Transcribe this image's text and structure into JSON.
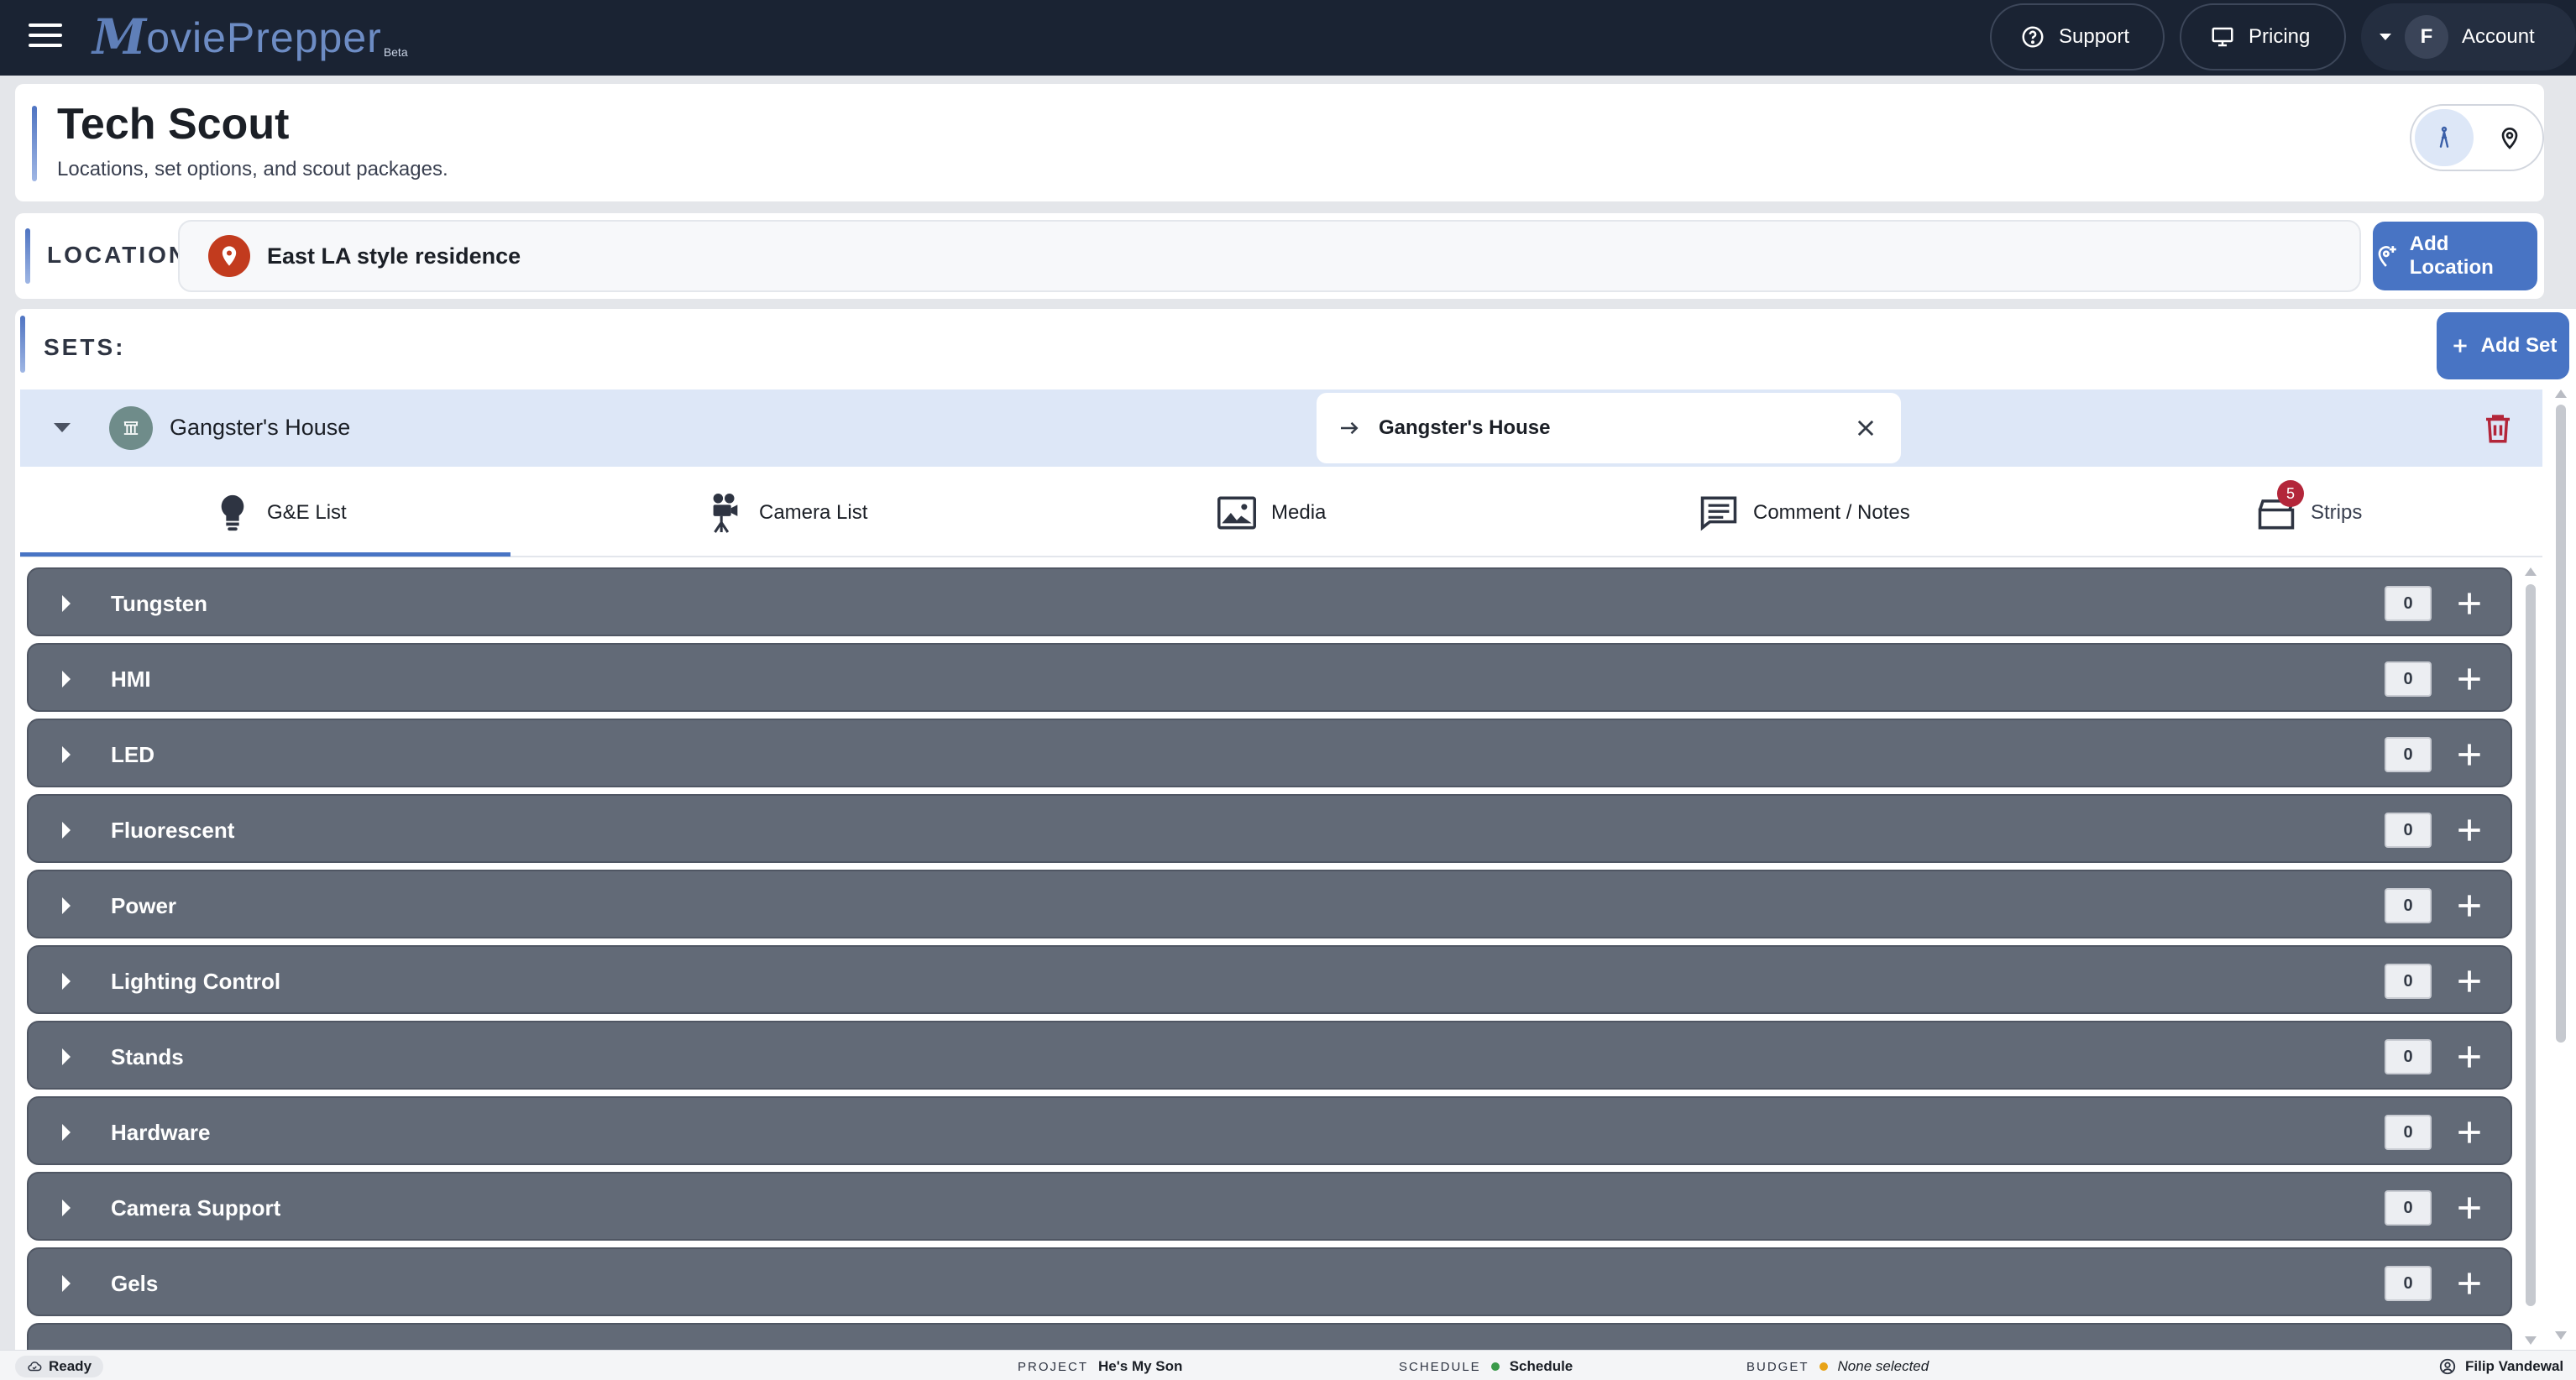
{
  "topbar": {
    "logo_initial": "M",
    "logo_rest": "oviePrepper",
    "logo_badge": "Beta",
    "support_label": "Support",
    "pricing_label": "Pricing",
    "account_initial": "F",
    "account_label": "Account"
  },
  "header": {
    "title": "Tech Scout",
    "subtitle": "Locations, set options, and scout packages."
  },
  "location": {
    "label": "LOCATION",
    "value": "East LA style residence",
    "add_button": "Add Location"
  },
  "sets": {
    "label": "SETS:",
    "add_button": "Add Set",
    "current_set": {
      "name": "Gangster's House",
      "linked_name": "Gangster's House"
    }
  },
  "tabs": [
    {
      "label": "G&E List",
      "active": true
    },
    {
      "label": "Camera List"
    },
    {
      "label": "Media"
    },
    {
      "label": "Comment / Notes"
    },
    {
      "label": "Strips",
      "badge": "5"
    }
  ],
  "categories": [
    {
      "name": "Tungsten",
      "count": "0"
    },
    {
      "name": "HMI",
      "count": "0"
    },
    {
      "name": "LED",
      "count": "0"
    },
    {
      "name": "Fluorescent",
      "count": "0"
    },
    {
      "name": "Power",
      "count": "0"
    },
    {
      "name": "Lighting Control",
      "count": "0"
    },
    {
      "name": "Stands",
      "count": "0"
    },
    {
      "name": "Hardware",
      "count": "0"
    },
    {
      "name": "Camera Support",
      "count": "0"
    },
    {
      "name": "Gels",
      "count": "0"
    }
  ],
  "statusbar": {
    "ready": "Ready",
    "project_key": "PROJECT",
    "project_value": "He's My Son",
    "schedule_key": "SCHEDULE",
    "schedule_value": "Schedule",
    "budget_key": "BUDGET",
    "budget_value": "None selected",
    "user": "Filip Vandewal"
  },
  "colors": {
    "topbar_bg": "#1a2333",
    "accent_blue": "#4874c4",
    "category_row_bg": "#626a77",
    "set_row_bg": "#dde7f7",
    "location_pin": "#c23b1e",
    "danger": "#b3263a",
    "schedule_dot": "#3a9a4a",
    "budget_dot": "#e8a317"
  },
  "icons": {
    "menu": "hamburger-icon",
    "support": "help-circle-icon",
    "pricing": "monitor-icon",
    "walk_view": "person-walking-icon",
    "map_view": "map-pin-icon",
    "location": "map-pin-icon",
    "add_location": "add-location-icon",
    "set": "set-building-icon",
    "link": "arrow-right-icon",
    "close": "close-icon",
    "delete": "trash-icon",
    "ge_list": "lightbulb-icon",
    "camera_list": "movie-camera-icon",
    "media": "image-icon",
    "notes": "comment-icon",
    "strips": "clapperboard-icon"
  }
}
